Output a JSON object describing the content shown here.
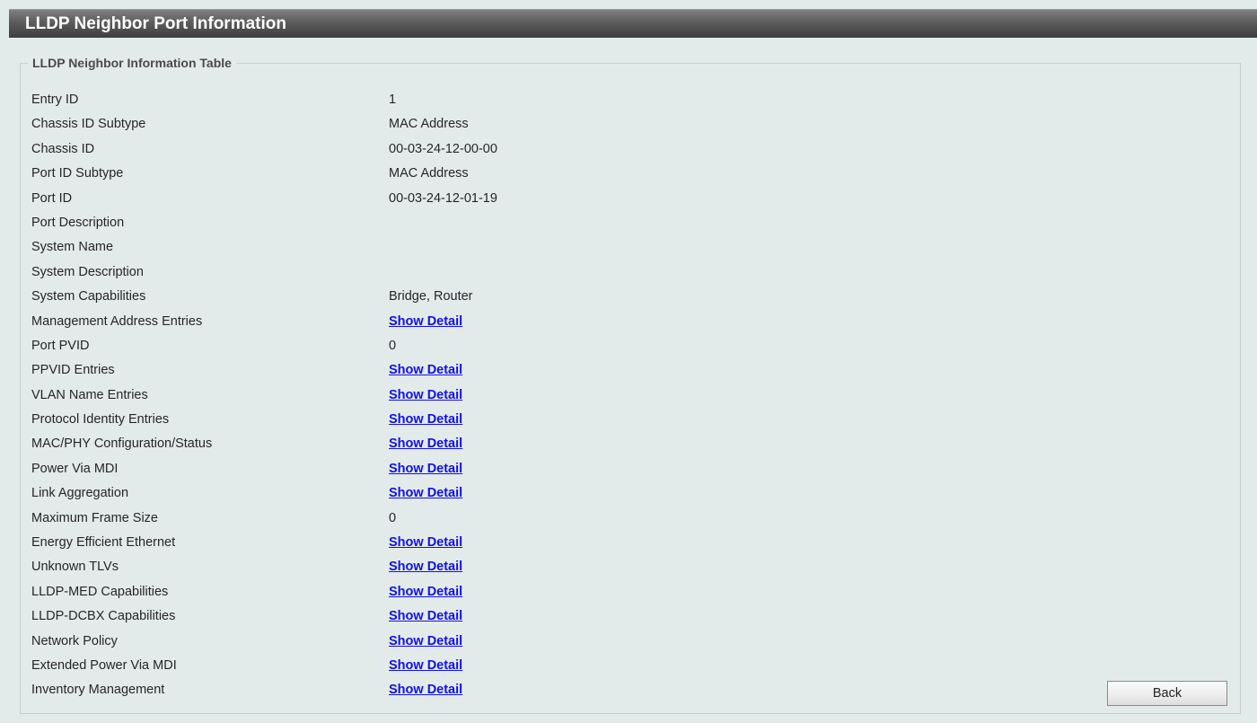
{
  "title": "LLDP Neighbor Port Information",
  "section_title": "LLDP Neighbor Information Table",
  "rows": [
    {
      "label": "Entry ID",
      "value": "1",
      "is_link": false
    },
    {
      "label": "Chassis ID Subtype",
      "value": "MAC Address",
      "is_link": false
    },
    {
      "label": "Chassis ID",
      "value": "00-03-24-12-00-00",
      "is_link": false
    },
    {
      "label": "Port ID Subtype",
      "value": "MAC Address",
      "is_link": false
    },
    {
      "label": "Port ID",
      "value": "00-03-24-12-01-19",
      "is_link": false
    },
    {
      "label": "Port Description",
      "value": "",
      "is_link": false
    },
    {
      "label": "System Name",
      "value": "",
      "is_link": false
    },
    {
      "label": "System Description",
      "value": "",
      "is_link": false
    },
    {
      "label": "System Capabilities",
      "value": "Bridge, Router",
      "is_link": false
    },
    {
      "label": "Management Address Entries",
      "value": "Show Detail",
      "is_link": true
    },
    {
      "label": "Port PVID",
      "value": "0",
      "is_link": false
    },
    {
      "label": "PPVID Entries",
      "value": "Show Detail",
      "is_link": true
    },
    {
      "label": "VLAN Name Entries",
      "value": "Show Detail",
      "is_link": true
    },
    {
      "label": "Protocol Identity Entries",
      "value": "Show Detail",
      "is_link": true
    },
    {
      "label": "MAC/PHY Configuration/Status",
      "value": "Show Detail",
      "is_link": true
    },
    {
      "label": "Power Via MDI",
      "value": "Show Detail",
      "is_link": true
    },
    {
      "label": "Link Aggregation",
      "value": "Show Detail",
      "is_link": true
    },
    {
      "label": "Maximum Frame Size",
      "value": "0",
      "is_link": false
    },
    {
      "label": "Energy Efficient Ethernet",
      "value": "Show Detail",
      "is_link": true
    },
    {
      "label": "Unknown TLVs",
      "value": "Show Detail",
      "is_link": true
    },
    {
      "label": "LLDP-MED Capabilities",
      "value": "Show Detail",
      "is_link": true
    },
    {
      "label": "LLDP-DCBX Capabilities",
      "value": "Show Detail",
      "is_link": true
    },
    {
      "label": "Network Policy",
      "value": "Show Detail",
      "is_link": true
    },
    {
      "label": "Extended Power Via MDI",
      "value": "Show Detail",
      "is_link": true
    },
    {
      "label": "Inventory Management",
      "value": "Show Detail",
      "is_link": true
    }
  ],
  "back_button": "Back",
  "colors": {
    "background": "#e3ebea",
    "link": "#1010ee",
    "title_bar": "#5c5c5c"
  }
}
